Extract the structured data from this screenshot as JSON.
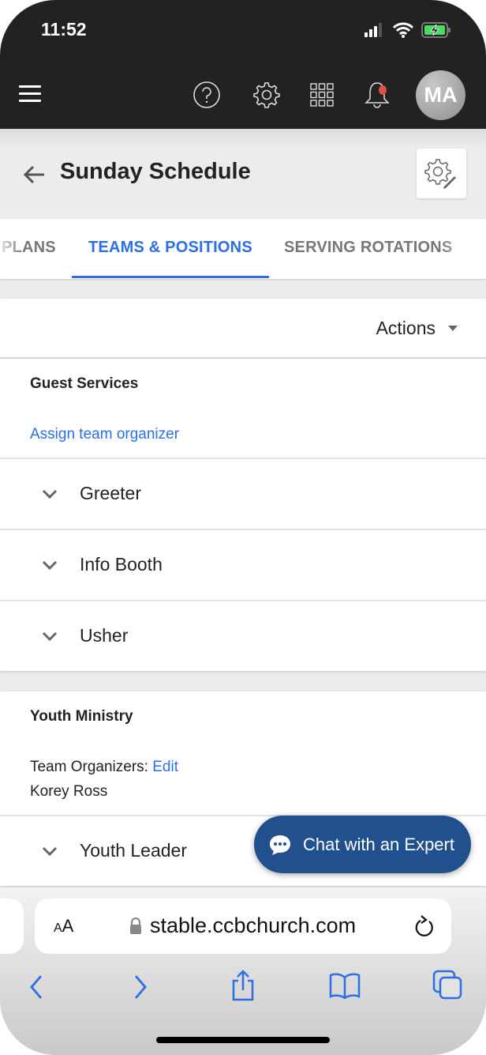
{
  "status_bar": {
    "time": "11:52",
    "icons": [
      "cellular-signal-icon",
      "wifi-icon",
      "battery-charging-icon"
    ]
  },
  "app_header": {
    "icons": [
      "menu-icon",
      "help-icon",
      "gear-icon",
      "apps-grid-icon",
      "bell-icon"
    ],
    "notification_dot_color": "#e0504a",
    "avatar_initials": "MA"
  },
  "page": {
    "title": "Sunday Schedule",
    "back_icon": "arrow-left-icon",
    "settings_icon": "gear-pencil-icon"
  },
  "tabs": [
    {
      "label": "PLANS",
      "active": false
    },
    {
      "label": "TEAMS & POSITIONS",
      "active": true
    },
    {
      "label": "SERVING ROTATIONS",
      "active": false
    }
  ],
  "accent_color": "#2d6ee6",
  "actions": {
    "label": "Actions"
  },
  "teams": [
    {
      "name": "Guest Services",
      "assign_link": "Assign team organizer",
      "positions": [
        "Greeter",
        "Info Booth",
        "Usher"
      ]
    },
    {
      "name": "Youth Ministry",
      "organizers_label": "Team Organizers:",
      "edit_link": "Edit",
      "organizer_name": "Korey Ross",
      "positions": [
        "Youth Leader"
      ]
    }
  ],
  "chat": {
    "label": "Chat with an Expert",
    "color": "#20508e"
  },
  "browser": {
    "text_size_label_small": "A",
    "text_size_label_large": "A",
    "url": "stable.ccbchurch.com",
    "toolbar_icons": [
      "back-icon",
      "forward-icon",
      "share-icon",
      "bookmarks-icon",
      "tabs-icon"
    ]
  }
}
